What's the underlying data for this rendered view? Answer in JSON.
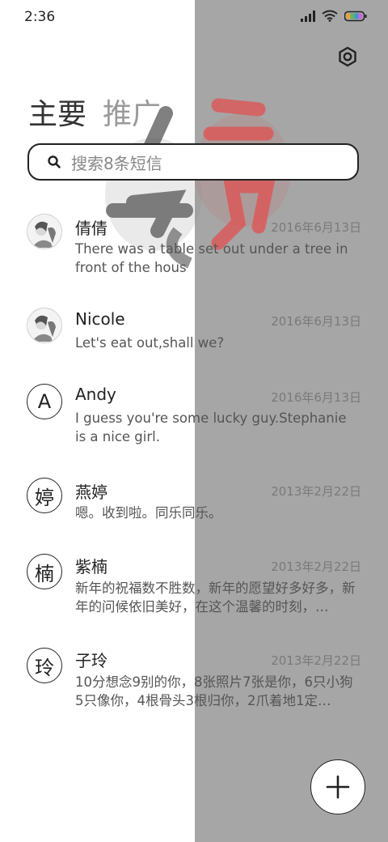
{
  "status_bar": {
    "time": "2:36"
  },
  "tabs": [
    {
      "label": "主要",
      "active": true
    },
    {
      "label": "推广",
      "active": false
    }
  ],
  "search": {
    "placeholder": "搜索8条短信"
  },
  "conversations": [
    {
      "name": "倩倩",
      "date": "2016年6月13日",
      "preview": "There was a table set out under a tree in front of the hous",
      "avatar": "photo"
    },
    {
      "name": "Nicole",
      "date": "2016年6月13日",
      "preview": "Let's eat out,shall we?",
      "avatar": "photo"
    },
    {
      "name": "Andy",
      "date": "2016年6月13日",
      "preview": "I guess you're some lucky guy.Stephanie is a nice girl.",
      "avatar": "A"
    },
    {
      "name": "燕婷",
      "date": "2013年2月22日",
      "preview": "嗯。收到啦。同乐同乐。",
      "avatar": "婷"
    },
    {
      "name": "紫楠",
      "date": "2013年2月22日",
      "preview": "新年的祝福数不胜数，新年的愿望好多好多，新年的问候依旧美好，在这个温馨的时刻，…",
      "avatar": "楠"
    },
    {
      "name": "子玲",
      "date": "2013年2月22日",
      "preview": "10分想念9别的你，8张照片7张是你，6只小狗5只像你，4根骨头3根归你，2爪着地1定…",
      "avatar": "玲"
    }
  ],
  "icons": {
    "settings": "gear-icon",
    "search": "search-icon",
    "compose": "plus-icon"
  },
  "colors": {
    "background_left": "#ffffff",
    "background_right": "#a6a6a6",
    "watermark_red": "#e05050"
  }
}
